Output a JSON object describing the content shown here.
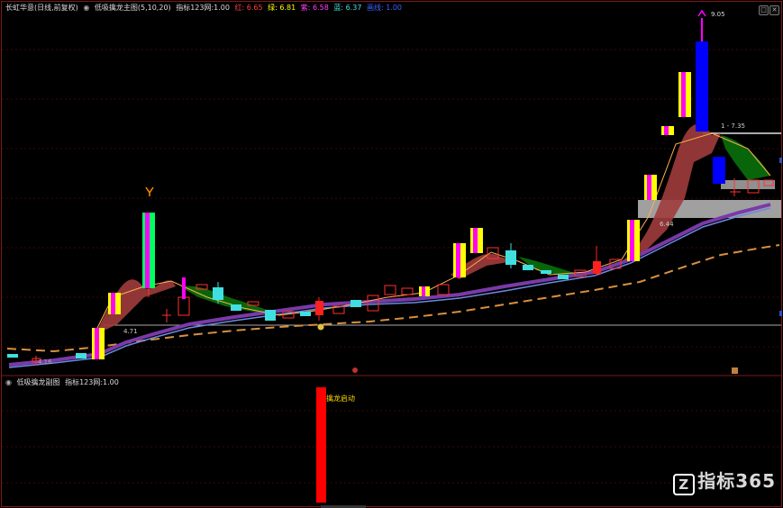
{
  "stock_title": "长虹华意(日线,前复权)",
  "main_indicator": {
    "name": "低吸擒龙主图(5,10,20)",
    "caption": "指标123网:",
    "caption_value": "1.00",
    "red_label": "红: 6.65",
    "green_label": "绿: 6.81",
    "purple_label": "紫: 6.58",
    "blue_label": "蓝: 6.37",
    "line_label": "画线: 1.00"
  },
  "sub_indicator": {
    "name": "低吸擒龙副图",
    "caption": "指标123网:",
    "caption_value": "1.00"
  },
  "signal_text": "擒龙启动",
  "price_labels": {
    "high": "9.05",
    "resistance": "1 - 7.35",
    "support_mid": "6.44",
    "support_low": "4.71",
    "low": "4.16"
  },
  "watermark": "指标365",
  "watermark_logo": "Z",
  "colors": {
    "background": "#000000",
    "up": "#ff3030",
    "down_cyan": "#40e0e0",
    "magenta": "#ff00ff",
    "yellow": "#ffff00",
    "green": "#00ff60",
    "blue": "#0000ff",
    "ribbon_red": "#a03c3c",
    "ribbon_green": "#0a6a0a",
    "ma_purple": "#8040b0",
    "dash_orange": "#e09040",
    "grid_red": "#5a1010"
  },
  "icons": [
    "collapse-icon",
    "settings-icon",
    "arrow-up-icon",
    "coin-icon",
    "zoom-icon"
  ]
}
